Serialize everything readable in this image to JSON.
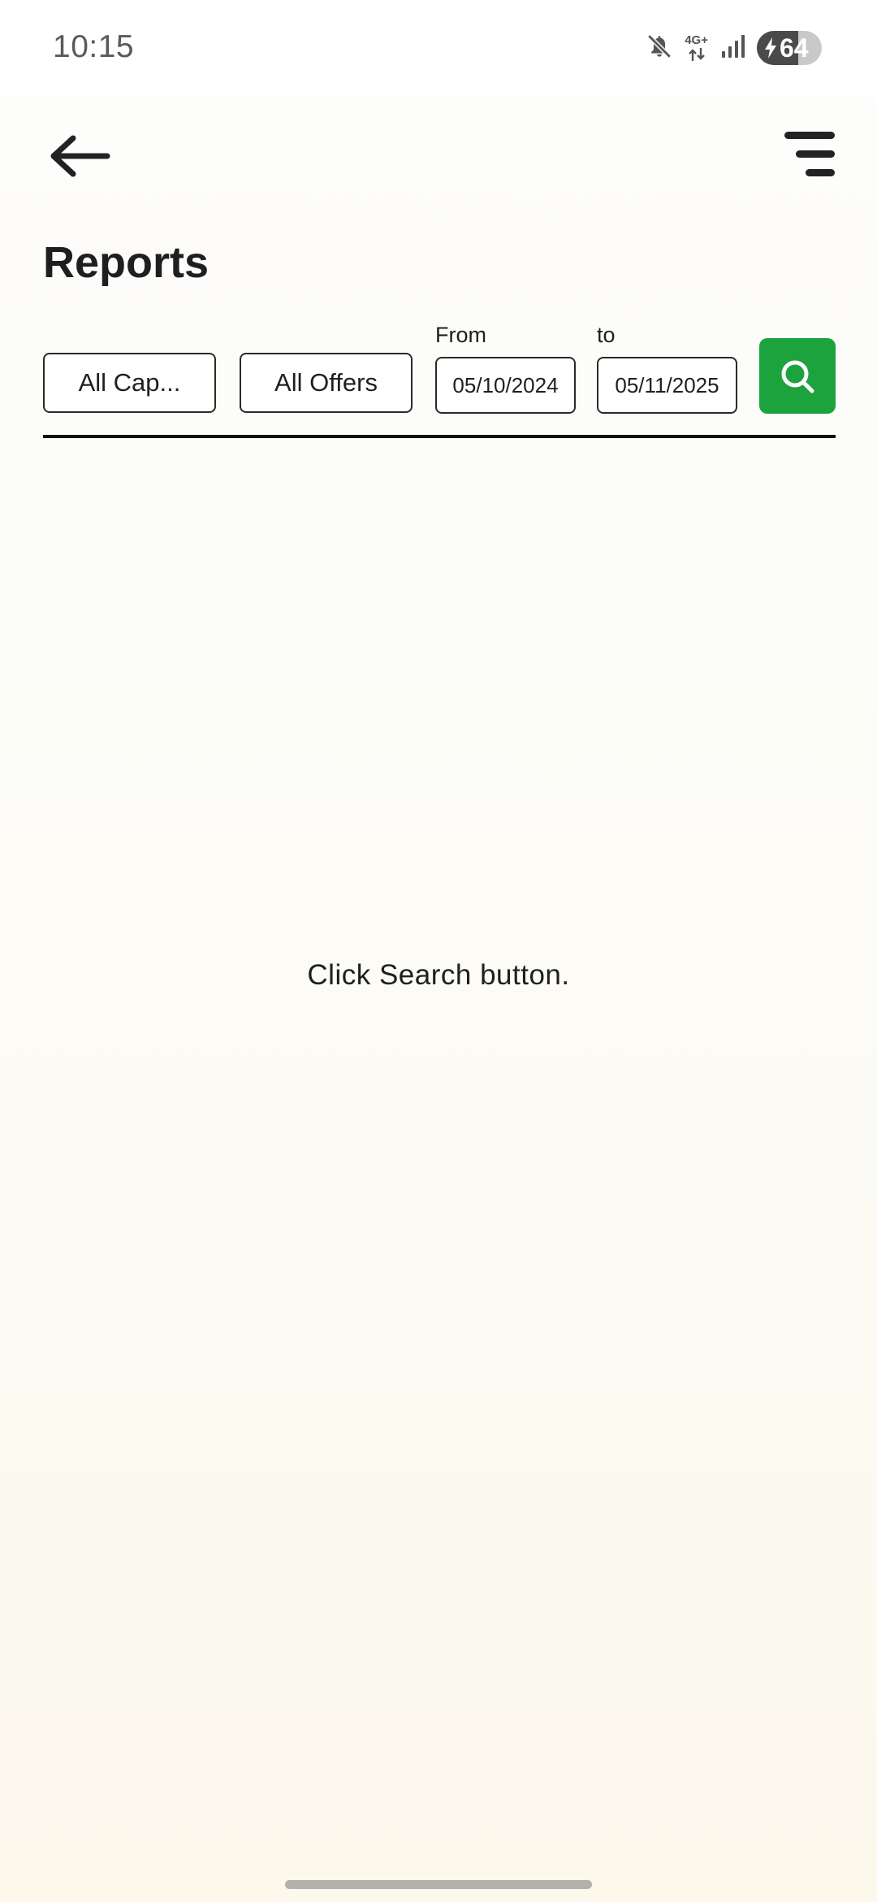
{
  "status_bar": {
    "time": "10:15",
    "network_label": "4G+",
    "battery_level": "64",
    "icons": [
      "mute-icon",
      "network-arrows-icon",
      "signal-icon",
      "battery-charging-icon"
    ]
  },
  "app_bar": {
    "back_icon": "arrow-left-icon",
    "menu_icon": "menu-icon"
  },
  "page": {
    "title": "Reports"
  },
  "filters": {
    "category_label": "All Cap...",
    "offers_label": "All Offers",
    "from_label": "From",
    "from_value": "05/10/2024",
    "to_label": "to",
    "to_value": "05/11/2025",
    "search_icon": "search-icon"
  },
  "empty_state": {
    "message": "Click Search button."
  },
  "colors": {
    "accent": "#1ca33e",
    "text": "#1f1f1f",
    "background_top": "#fdfdfb",
    "background_bottom": "#fcf8ec"
  }
}
